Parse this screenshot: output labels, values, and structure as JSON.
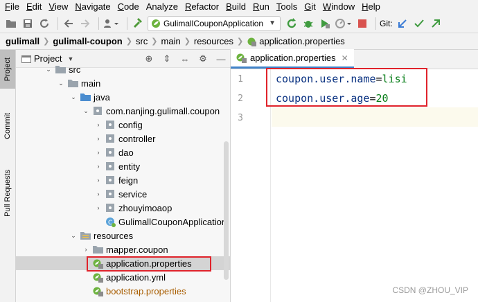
{
  "menu": {
    "items": [
      {
        "mnemonic": "F",
        "rest": "ile"
      },
      {
        "mnemonic": "E",
        "rest": "dit"
      },
      {
        "mnemonic": "V",
        "rest": "iew"
      },
      {
        "mnemonic": "N",
        "rest": "avigate"
      },
      {
        "mnemonic": "C",
        "rest": "ode"
      },
      {
        "mnemonic": "",
        "rest": "Analyze"
      },
      {
        "mnemonic": "R",
        "rest": "efactor"
      },
      {
        "mnemonic": "B",
        "rest": "uild"
      },
      {
        "mnemonic": "R",
        "rest": "un"
      },
      {
        "mnemonic": "T",
        "rest": "ools"
      },
      {
        "mnemonic": "G",
        "rest": "it"
      },
      {
        "mnemonic": "W",
        "rest": "indow"
      },
      {
        "mnemonic": "H",
        "rest": "elp"
      }
    ]
  },
  "toolbar": {
    "run_config": "GulimallCouponApplication",
    "git_label": "Git:"
  },
  "breadcrumb": [
    "gulimall",
    "gulimall-coupon",
    "src",
    "main",
    "resources",
    "application.properties"
  ],
  "left_strip": {
    "project": "Project",
    "commit": "Commit",
    "pull_requests": "Pull Requests"
  },
  "project_panel": {
    "title": "Project"
  },
  "tree": [
    {
      "label": "src",
      "expanded": true,
      "type": "folder"
    },
    {
      "label": "main",
      "expanded": true,
      "type": "folder"
    },
    {
      "label": "java",
      "expanded": true,
      "type": "source-folder"
    },
    {
      "label": "com.nanjing.gulimall.coupon",
      "expanded": true,
      "type": "package"
    },
    {
      "label": "config",
      "expanded": false,
      "type": "package"
    },
    {
      "label": "controller",
      "expanded": false,
      "type": "package"
    },
    {
      "label": "dao",
      "expanded": false,
      "type": "package"
    },
    {
      "label": "entity",
      "expanded": false,
      "type": "package"
    },
    {
      "label": "feign",
      "expanded": false,
      "type": "package"
    },
    {
      "label": "service",
      "expanded": false,
      "type": "package"
    },
    {
      "label": "zhouyimoaop",
      "expanded": false,
      "type": "package"
    },
    {
      "label": "GulimallCouponApplication",
      "type": "spring-class"
    },
    {
      "label": "resources",
      "expanded": true,
      "type": "resources-folder"
    },
    {
      "label": "mapper.coupon",
      "expanded": false,
      "type": "folder"
    },
    {
      "label": "application.properties",
      "type": "spring-config",
      "selected": true
    },
    {
      "label": "application.yml",
      "type": "spring-config"
    },
    {
      "label": "bootstrap.properties",
      "type": "spring-config-modified"
    }
  ],
  "editor": {
    "tab_label": "application.properties",
    "lines": [
      {
        "number": "1",
        "key": "coupon.user.name",
        "eq": "=",
        "value": "lisi"
      },
      {
        "number": "2",
        "key": "coupon.user.age",
        "eq": "=",
        "value": "20"
      },
      {
        "number": "3",
        "key": "",
        "eq": "",
        "value": ""
      }
    ]
  },
  "watermark": "CSDN @ZHOU_VIP",
  "colors": {
    "highlight_box": "#e0232b",
    "key": "#083080",
    "value": "#067d17",
    "spring_green": "#6db33f"
  }
}
